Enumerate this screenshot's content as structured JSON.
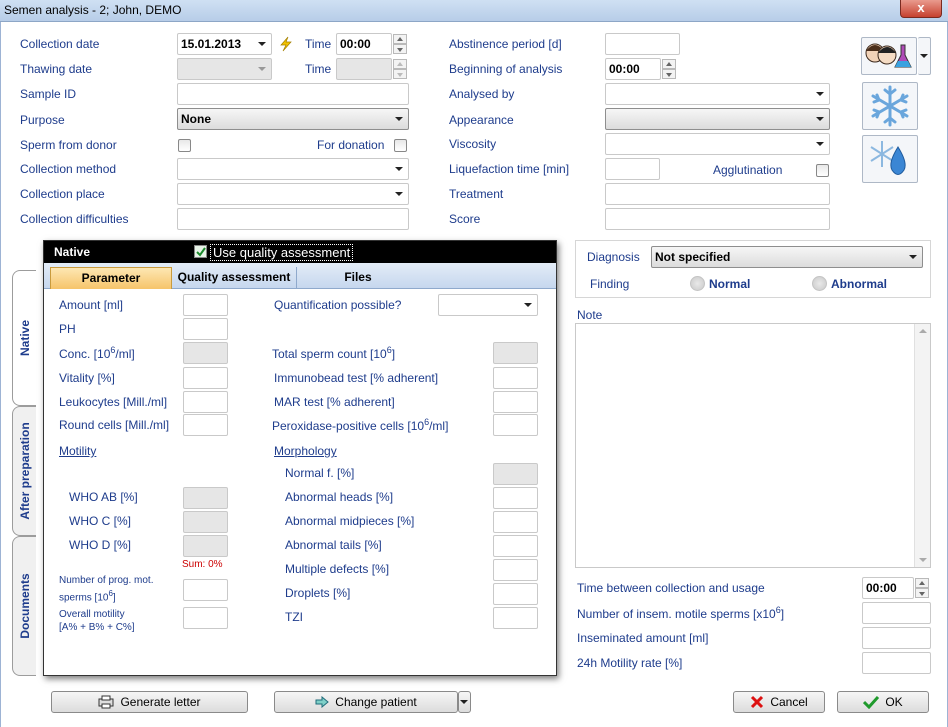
{
  "window": {
    "title": "Semen analysis - 2; John, DEMO",
    "close_glyph": "x"
  },
  "left_form": {
    "collection_date_label": "Collection date",
    "collection_date_value": "15.01.2013",
    "time_label": "Time",
    "time_value": "00:00",
    "thawing_date_label": "Thawing date",
    "thawing_time_label": "Time",
    "sample_id_label": "Sample ID",
    "purpose_label": "Purpose",
    "purpose_value": "None",
    "sperm_from_donor_label": "Sperm from donor",
    "for_donation_label": "For donation",
    "collection_method_label": "Collection method",
    "collection_place_label": "Collection place",
    "collection_difficulties_label": "Collection difficulties"
  },
  "right_form": {
    "abstinence_label": "Abstinence period [d]",
    "beginning_label": "Beginning of analysis",
    "beginning_value": "00:00",
    "analysed_by_label": "Analysed by",
    "appearance_label": "Appearance",
    "viscosity_label": "Viscosity",
    "liquefaction_label": "Liquefaction time [min]",
    "agglutination_label": "Agglutination",
    "treatment_label": "Treatment",
    "score_label": "Score"
  },
  "side_tabs": [
    "Native",
    "After preparation",
    "Documents"
  ],
  "panel": {
    "title": "Native",
    "use_quality_label": "Use quality assessment",
    "tabs": [
      "Parameter",
      "Quality assessment",
      "Files"
    ],
    "left": {
      "amount": "Amount [ml]",
      "ph": "PH",
      "conc_pre": "Conc. [10",
      "conc_sup": "6",
      "conc_post": "/ml]",
      "vitality": "Vitality [%]",
      "leukocytes": "Leukocytes [Mill./ml]",
      "round_cells": "Round cells [Mill./ml]",
      "motility": "Motility",
      "who_ab": "WHO AB [%]",
      "who_c": "WHO C [%]",
      "who_d": "WHO D [%]",
      "sum": "Sum: 0%",
      "prog_line1": "Number of prog. mot.",
      "prog_line2_pre": "sperms [10",
      "prog_line2_sup": "6",
      "prog_line2_post": "]",
      "overall_line1": "Overall motility",
      "overall_line2": "[A% + B% + C%]"
    },
    "right": {
      "quant": "Quantification possible?",
      "total_pre": "Total sperm count [10",
      "total_sup": "6",
      "total_post": "]",
      "immunobead": "Immunobead test [% adherent]",
      "mar": "MAR test [% adherent]",
      "perox_pre": "Peroxidase-positive cells [10",
      "perox_sup": "6",
      "perox_post": "/ml]",
      "morphology": "Morphology",
      "normal": "Normal f. [%]",
      "abn_heads": "Abnormal heads [%]",
      "abn_mid": "Abnormal midpieces [%]",
      "abn_tails": "Abnormal tails [%]",
      "multi": "Multiple defects [%]",
      "droplets": "Droplets [%]",
      "tzi": "TZI"
    }
  },
  "diagnosis": {
    "label": "Diagnosis",
    "value": "Not specified",
    "finding_label": "Finding",
    "normal": "Normal",
    "abnormal": "Abnormal"
  },
  "note_label": "Note",
  "bottom_right": {
    "time_between": "Time between collection and usage",
    "time_value": "00:00",
    "insem_pre": "Number of insem. motile sperms [x10",
    "insem_sup": "6",
    "insem_post": "]",
    "insem_amount": "Inseminated amount [ml]",
    "motility_rate": "24h Motility rate [%]"
  },
  "buttons": {
    "generate": "Generate letter",
    "change_patient": "Change patient",
    "cancel": "Cancel",
    "ok": "OK"
  },
  "colors": {
    "label_blue": "#1e3c8c",
    "sum_red": "#cc0000"
  }
}
